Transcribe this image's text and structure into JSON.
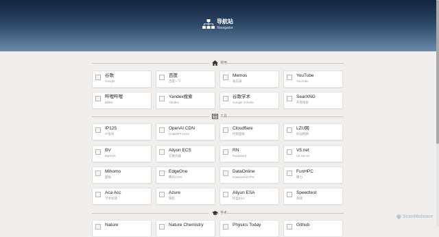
{
  "header": {
    "title": "导航站",
    "subtitle": "Navigator",
    "icon": "sitemap-icon"
  },
  "sections": [
    {
      "icon": "home-icon",
      "label": "常用",
      "cards": [
        {
          "title": "谷歌",
          "sub": "Google"
        },
        {
          "title": "百度",
          "sub": "百度一下"
        },
        {
          "title": "Memos",
          "sub": "备忘录"
        },
        {
          "title": "YouTube",
          "sub": "YouTube"
        },
        {
          "title": "哔哩哔哩",
          "sub": "Bilibili"
        },
        {
          "title": "Yandex搜索",
          "sub": "Yandex"
        },
        {
          "title": "谷歌学术",
          "sub": "Google Scholar"
        },
        {
          "title": "SearXNG",
          "sub": "开源搜索"
        }
      ]
    },
    {
      "icon": "server-icon",
      "label": "工具",
      "cards": [
        {
          "title": "IP125",
          "sub": "IP查询"
        },
        {
          "title": "OpenAI CDN",
          "sub": "ChatGPT CDN"
        },
        {
          "title": "Cloudflare",
          "sub": "控制面板"
        },
        {
          "title": "LZU网",
          "sub": "校园网络"
        },
        {
          "title": "BV",
          "sub": "ByteVirt"
        },
        {
          "title": "Aliyun ECS",
          "sub": "云服务器"
        },
        {
          "title": "RN",
          "sub": "RackNerd"
        },
        {
          "title": "V5.net",
          "sub": "V5 Server"
        },
        {
          "title": "Mihomo",
          "sub": "面板"
        },
        {
          "title": "EdgeOne",
          "sub": "腾讯CDN"
        },
        {
          "title": "DataOnline",
          "sub": "DataOnlineVPS"
        },
        {
          "title": "FunHPC",
          "sub": "算力"
        },
        {
          "title": "Aca Acc",
          "sub": "学术加速"
        },
        {
          "title": "Azure",
          "sub": "微软"
        },
        {
          "title": "Aliyun ESA",
          "sub": "阿里ESA"
        },
        {
          "title": "Speedtest",
          "sub": "测速"
        }
      ]
    },
    {
      "icon": "graduation-cap-icon",
      "label": "学术",
      "cards": [
        {
          "title": "Nature",
          "sub": ""
        },
        {
          "title": "Nature Chemistry",
          "sub": ""
        },
        {
          "title": "Physics Today",
          "sub": ""
        },
        {
          "title": "Github",
          "sub": ""
        }
      ]
    }
  ],
  "watermark": {
    "text": "ScanMalware",
    "icon": "shield-icon",
    "color": "#b9c4cf"
  },
  "colors": {
    "header_top": "#14233d",
    "header_bottom": "#6b8bab",
    "page_bg": "#f1eeec"
  }
}
